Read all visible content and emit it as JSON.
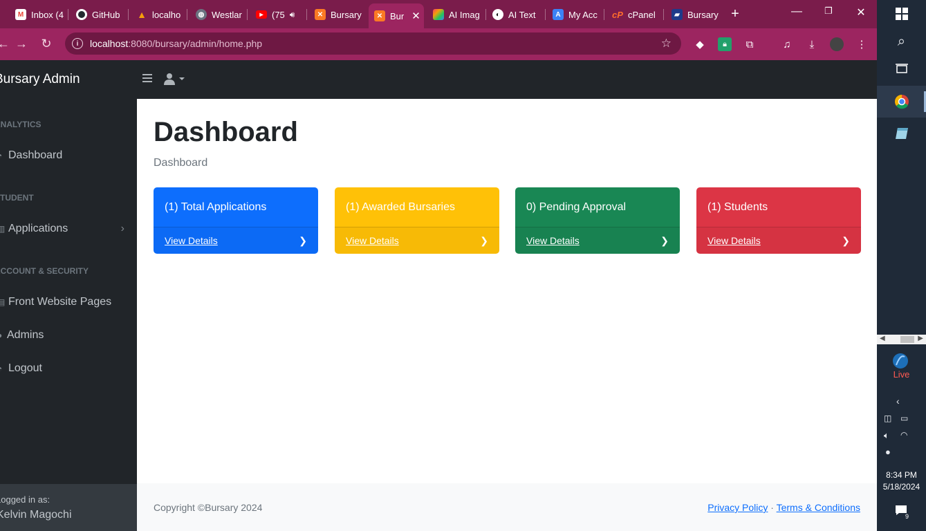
{
  "browser": {
    "tabs": [
      {
        "label": "Inbox (4",
        "icon": "gmail-icon",
        "color": "#ea4335"
      },
      {
        "label": "GitHub",
        "icon": "github-icon",
        "color": "#24292f"
      },
      {
        "label": "localho",
        "icon": "localhost-icon",
        "color": "#f59e0b"
      },
      {
        "label": "Westlar",
        "icon": "globe-icon",
        "color": "#6b7280"
      },
      {
        "label": "(75",
        "icon": "youtube-icon",
        "color": "#ff0000"
      },
      {
        "label": "Bursary",
        "icon": "xampp-icon",
        "color": "#fb7a24"
      },
      {
        "label": "Bur",
        "icon": "xampp-icon",
        "color": "#fb7a24"
      },
      {
        "label": "AI Imag",
        "icon": "ai-image-icon",
        "color": "#8b5cf6"
      },
      {
        "label": "AI Text",
        "icon": "ai-text-icon",
        "color": "#111827"
      },
      {
        "label": "My Acc",
        "icon": "account-icon",
        "color": "#3b82f6"
      },
      {
        "label": "cPanel",
        "icon": "cpanel-icon",
        "color": "#ff6c2c"
      },
      {
        "label": "Bursary",
        "icon": "graduation-cap-icon",
        "color": "#1e3a8a"
      }
    ],
    "url_host": "localhost",
    "url_path": ":8080/bursary/admin/home.php"
  },
  "sidebar": {
    "brand": "Bursary Admin",
    "headings": {
      "analytics": "ANALYTICS",
      "student": "STUDENT",
      "account": "ACCOUNT & SECURITY"
    },
    "items": {
      "dashboard": "Dashboard",
      "applications": "Applications",
      "front_pages": "Front Website Pages",
      "admins": "Admins",
      "logout": "Logout"
    },
    "footer": {
      "logged_in_as": "Logged in as:",
      "user": "Kelvin Magochi"
    }
  },
  "main": {
    "title": "Dashboard",
    "breadcrumb": "Dashboard",
    "cards": [
      {
        "label": "(1) Total Applications",
        "link": "View Details",
        "color": "#0d6efd"
      },
      {
        "label": "(1) Awarded Bursaries",
        "link": "View Details",
        "color": "#ffc107"
      },
      {
        "label": "0) Pending Approval",
        "link": "View Details",
        "color": "#198754"
      },
      {
        "label": "(1) Students",
        "link": "View Details",
        "color": "#dc3545"
      }
    ]
  },
  "footer": {
    "copyright": "Copyright ©Bursary 2024",
    "privacy": "Privacy Policy",
    "separator": "·",
    "terms": "Terms & Conditions"
  },
  "taskbar": {
    "live_label": "Live",
    "time": "8:34 PM",
    "date": "5/18/2024",
    "notifications": "9"
  }
}
